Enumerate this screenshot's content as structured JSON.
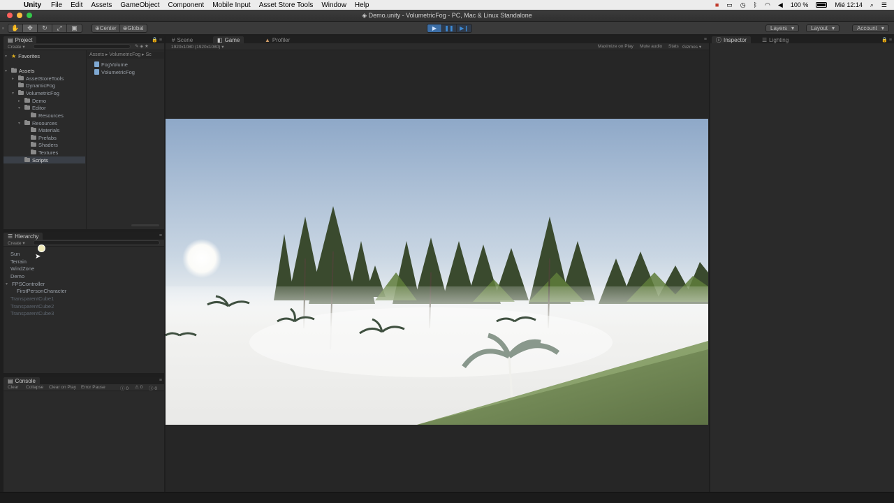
{
  "menubar": {
    "app": "Unity",
    "items": [
      "File",
      "Edit",
      "Assets",
      "GameObject",
      "Component",
      "Mobile Input",
      "Asset Store Tools",
      "Window",
      "Help"
    ],
    "battery": "100 %",
    "clock": "Mié 12:14"
  },
  "window": {
    "title": "Demo.unity - VolumetricFog - PC, Mac & Linux Standalone"
  },
  "toolbar": {
    "pivot": "Center",
    "space": "Global",
    "layers": "Layers",
    "layout": "Layout",
    "account": "Account"
  },
  "project": {
    "tab": "Project",
    "create": "Create",
    "favorites": "Favorites",
    "breadcrumb": [
      "Assets",
      "VolumetricFog",
      "Sc"
    ],
    "tree": [
      {
        "label": "Assets",
        "depth": 0
      },
      {
        "label": "AssetStoreTools",
        "depth": 1
      },
      {
        "label": "DynamicFog",
        "depth": 1
      },
      {
        "label": "VolumetricFog",
        "depth": 1
      },
      {
        "label": "Demo",
        "depth": 2
      },
      {
        "label": "Editor",
        "depth": 2
      },
      {
        "label": "Resources",
        "depth": 3
      },
      {
        "label": "Resources",
        "depth": 2
      },
      {
        "label": "Materials",
        "depth": 3
      },
      {
        "label": "Prefabs",
        "depth": 3
      },
      {
        "label": "Shaders",
        "depth": 3
      },
      {
        "label": "Textures",
        "depth": 3
      },
      {
        "label": "Scripts",
        "depth": 2
      }
    ],
    "files": [
      "FogVolume",
      "VolumetricFog"
    ]
  },
  "hierarchy": {
    "tab": "Hierarchy",
    "create": "Create",
    "items": [
      {
        "label": "Sun"
      },
      {
        "label": "Terrain"
      },
      {
        "label": "WindZone"
      },
      {
        "label": "Demo"
      },
      {
        "label": "FPSController"
      },
      {
        "label": "FirstPersonCharacter"
      },
      {
        "label": "TransparentCube1"
      },
      {
        "label": "TransparentCube2"
      },
      {
        "label": "TransparentCube3"
      }
    ]
  },
  "console": {
    "tab": "Console",
    "buttons": [
      "Clear",
      "Collapse",
      "Clear on Play",
      "Error Pause"
    ],
    "counts": [
      "0",
      "0",
      "0"
    ]
  },
  "center": {
    "tabs": [
      "Scene",
      "Game",
      "Profiler"
    ],
    "resolution": "1920x1080 (1920x1080)",
    "options": [
      "Maximize on Play",
      "Mute audio",
      "Stats",
      "Gizmos"
    ]
  },
  "right": {
    "tabs": [
      "Inspector",
      "Lighting"
    ]
  }
}
